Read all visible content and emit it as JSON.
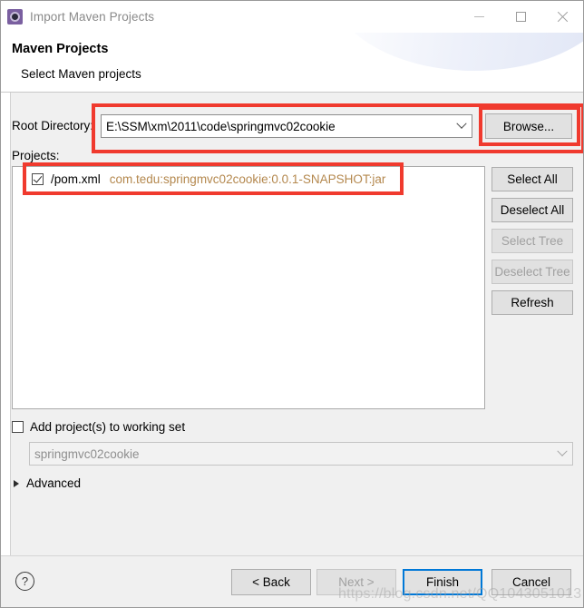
{
  "window": {
    "title": "Import Maven Projects",
    "icon": "maven-gear-icon",
    "minimize_tooltip": "Minimize",
    "maximize_tooltip": "Maximize",
    "close_tooltip": "Close"
  },
  "header": {
    "title": "Maven Projects",
    "subtitle": "Select Maven projects"
  },
  "form": {
    "root_directory_label": "Root Directory:",
    "root_directory_value": "E:\\SSM\\xm\\2011\\code\\springmvc02cookie",
    "browse_label": "Browse...",
    "projects_label": "Projects:"
  },
  "project_list": {
    "items": [
      {
        "checked": true,
        "name": "/pom.xml",
        "coordinates": "com.tedu:springmvc02cookie:0.0.1-SNAPSHOT:jar"
      }
    ]
  },
  "side_buttons": [
    {
      "label": "Select All",
      "enabled": true
    },
    {
      "label": "Deselect All",
      "enabled": true
    },
    {
      "label": "Select Tree",
      "enabled": false
    },
    {
      "label": "Deselect Tree",
      "enabled": false
    },
    {
      "label": "Refresh",
      "enabled": true
    }
  ],
  "working_set": {
    "checkbox_label": "Add project(s) to working set",
    "checked": false,
    "combo_value": "springmvc02cookie",
    "combo_enabled": false
  },
  "advanced": {
    "label": "Advanced",
    "expanded": false
  },
  "footer": {
    "help_glyph": "?",
    "back_label": "< Back",
    "next_label": "Next >",
    "next_enabled": false,
    "finish_label": "Finish",
    "cancel_label": "Cancel"
  },
  "watermark": {
    "text": "https://blog.csdn.net/QQ1043051013"
  },
  "colors": {
    "accent": "#0078d7",
    "annotation": "#f03a2e",
    "coordinates_text": "#b4884e",
    "title_icon": "#7a5fa0"
  }
}
